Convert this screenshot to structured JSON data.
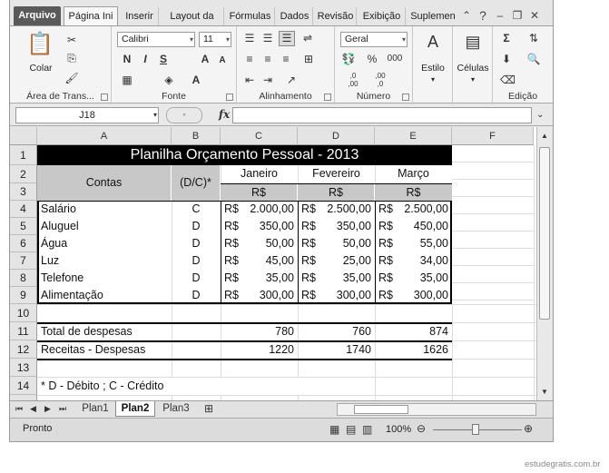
{
  "ribbon_tabs": [
    "Arquivo",
    "Página Ini",
    "Inserir",
    "Layout da",
    "Fórmulas",
    "Dados",
    "Revisão",
    "Exibição",
    "Suplemen"
  ],
  "clipboard": {
    "paste_label": "Colar",
    "group_label": "Área de Trans..."
  },
  "font": {
    "name": "Calibri",
    "size": "11",
    "bold": "N",
    "italic": "I",
    "underline": "S",
    "grow": "A",
    "shrink": "A",
    "group_label": "Fonte"
  },
  "alignment": {
    "group_label": "Alinhamento"
  },
  "number": {
    "format": "Geral",
    "percent": "%",
    "thousands": "000",
    "dec_more": ",0\n,00",
    "dec_less": ",00\n,0",
    "group_label": "Número"
  },
  "styles": {
    "label": "Estilo"
  },
  "cells": {
    "label": "Células"
  },
  "editing": {
    "sigma": "Σ",
    "group_label": "Edição"
  },
  "formula_bar": {
    "name_box": "J18",
    "fx": "fx",
    "formula": ""
  },
  "columns": [
    "A",
    "B",
    "C",
    "D",
    "E",
    "F"
  ],
  "rows": [
    "1",
    "2",
    "3",
    "4",
    "5",
    "6",
    "7",
    "8",
    "9",
    "10",
    "11",
    "12",
    "13",
    "14"
  ],
  "sheet": {
    "title": "Planilha Orçamento Pessoal - 2013",
    "contas_header": "Contas",
    "dc_header": "(D/C)*",
    "months": [
      "Janeiro",
      "Fevereiro",
      "Março"
    ],
    "currency": "R$",
    "items": [
      {
        "name": "Salário",
        "dc": "C",
        "jan": "2.000,00",
        "fev": "2.500,00",
        "mar": "2.500,00"
      },
      {
        "name": "Aluguel",
        "dc": "D",
        "jan": "350,00",
        "fev": "350,00",
        "mar": "450,00"
      },
      {
        "name": "Água",
        "dc": "D",
        "jan": "50,00",
        "fev": "50,00",
        "mar": "55,00"
      },
      {
        "name": "Luz",
        "dc": "D",
        "jan": "45,00",
        "fev": "25,00",
        "mar": "34,00"
      },
      {
        "name": "Telefone",
        "dc": "D",
        "jan": "35,00",
        "fev": "35,00",
        "mar": "35,00"
      },
      {
        "name": "Alimentação",
        "dc": "D",
        "jan": "300,00",
        "fev": "300,00",
        "mar": "300,00"
      }
    ],
    "total_label": "Total de despesas",
    "totals": [
      "780",
      "760",
      "874"
    ],
    "balance_label": "Receitas - Despesas",
    "balances": [
      "1220",
      "1740",
      "1626"
    ],
    "footnote": "* D - Débito ; C - Crédito"
  },
  "sheet_tabs": [
    "Plan1",
    "Plan2",
    "Plan3"
  ],
  "active_sheet": "Plan2",
  "status": {
    "ready": "Pronto",
    "zoom": "100%"
  },
  "watermark": "estudegratis.com.br"
}
